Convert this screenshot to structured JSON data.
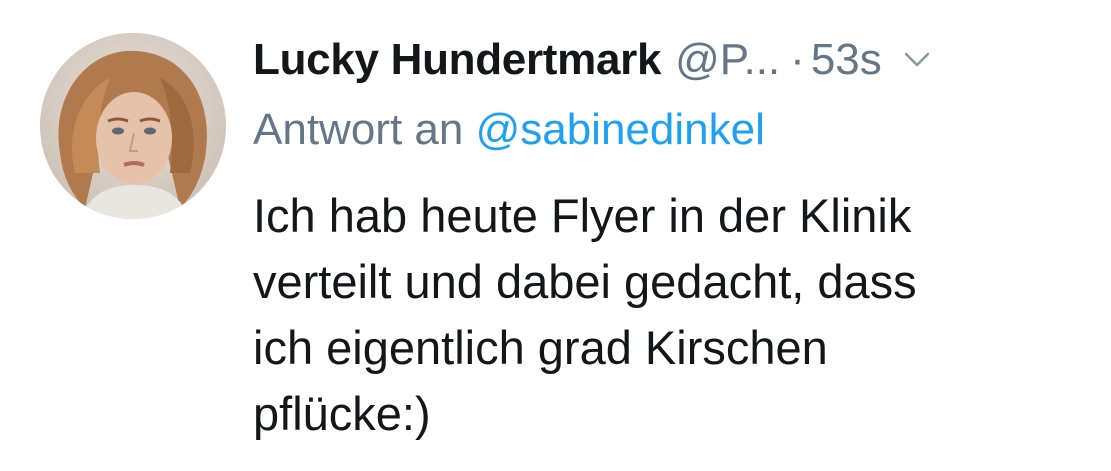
{
  "tweet": {
    "display_name": "Lucky Hundertmark",
    "handle": "@P...",
    "separator": "·",
    "timestamp": "53s",
    "reply_prefix": "Antwort an",
    "reply_mention": "@sabinedinkel",
    "text": "Ich hab heute Flyer in der Klinik\nverteilt und dabei gedacht, dass\nich eigentlich grad Kirschen\npflücke:)"
  },
  "icons": {
    "menu": "chevron-down-icon",
    "avatar": "avatar"
  },
  "colors": {
    "primary_text": "#14171a",
    "secondary_text": "#657786",
    "link": "#1da1f2",
    "background": "#ffffff"
  }
}
